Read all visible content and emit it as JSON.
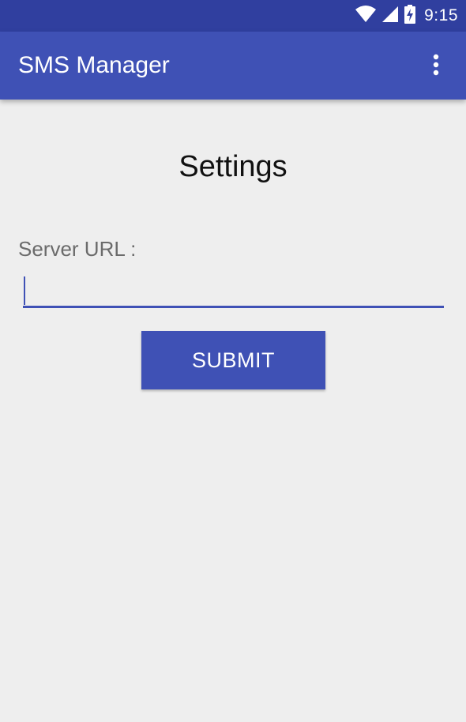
{
  "status_bar": {
    "time": "9:15",
    "icons": [
      "wifi-icon",
      "signal-icon",
      "battery-charging-icon"
    ],
    "background": "#303f9f"
  },
  "app_bar": {
    "title": "SMS Manager",
    "menu_icon": "more-vert-icon",
    "background": "#3f51b5"
  },
  "settings": {
    "title": "Settings",
    "server_url_label": "Server URL :",
    "server_url_value": "",
    "submit_label": "SUBMIT"
  },
  "colors": {
    "accent": "#3f51b5",
    "page_background": "#eeeeee"
  }
}
